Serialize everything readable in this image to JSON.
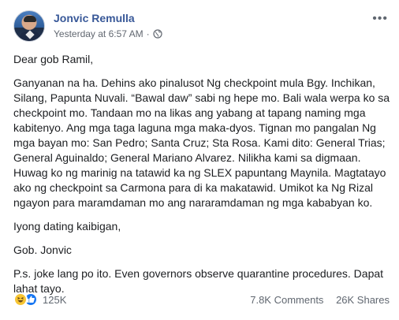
{
  "post": {
    "author": "Jonvic Remulla",
    "timestamp": "Yesterday at 6:57 AM",
    "separator": "·",
    "privacy_icon": "globe-icon",
    "more_icon": "more-options-icon",
    "paragraphs": [
      "Dear gob Ramil,",
      "Ganyanan na ha. Dehins ako pinalusot Ng checkpoint mula Bgy. Inchikan, Silang, Papunta Nuvali. “Bawal daw” sabi ng hepe mo. Bali wala werpa ko sa checkpoint mo. Tandaan mo na likas ang yabang at tapang naming mga kabitenyo. Ang mga taga laguna mga maka-dyos. Tignan mo pangalan Ng mga bayan mo: San Pedro; Santa Cruz; Sta Rosa. Kami dito: General Trias; General Aguinaldo; General Mariano Alvarez. Nilikha kami sa digmaan. Huwag ko ng marinig na tatawid ka ng SLEX papuntang Maynila. Magtatayo ako ng checkpoint sa Carmona para di ka makatawid. Umikot ka Ng Rizal ngayon para maramdaman mo ang nararamdaman ng mga kababyan ko.",
      "Iyong dating kaibigan,",
      "Gob. Jonvic",
      "P.s. joke lang po ito. Even governors observe quarantine procedures. Dapat lahat tayo."
    ]
  },
  "footer": {
    "reaction_icons": [
      "haha-icon",
      "like-icon"
    ],
    "reaction_count": "125K",
    "comments": "7.8K Comments",
    "shares": "26K Shares"
  },
  "colors": {
    "author": "#385898",
    "meta": "#616770",
    "like": "#1877f2",
    "haha": "#f7c533"
  }
}
